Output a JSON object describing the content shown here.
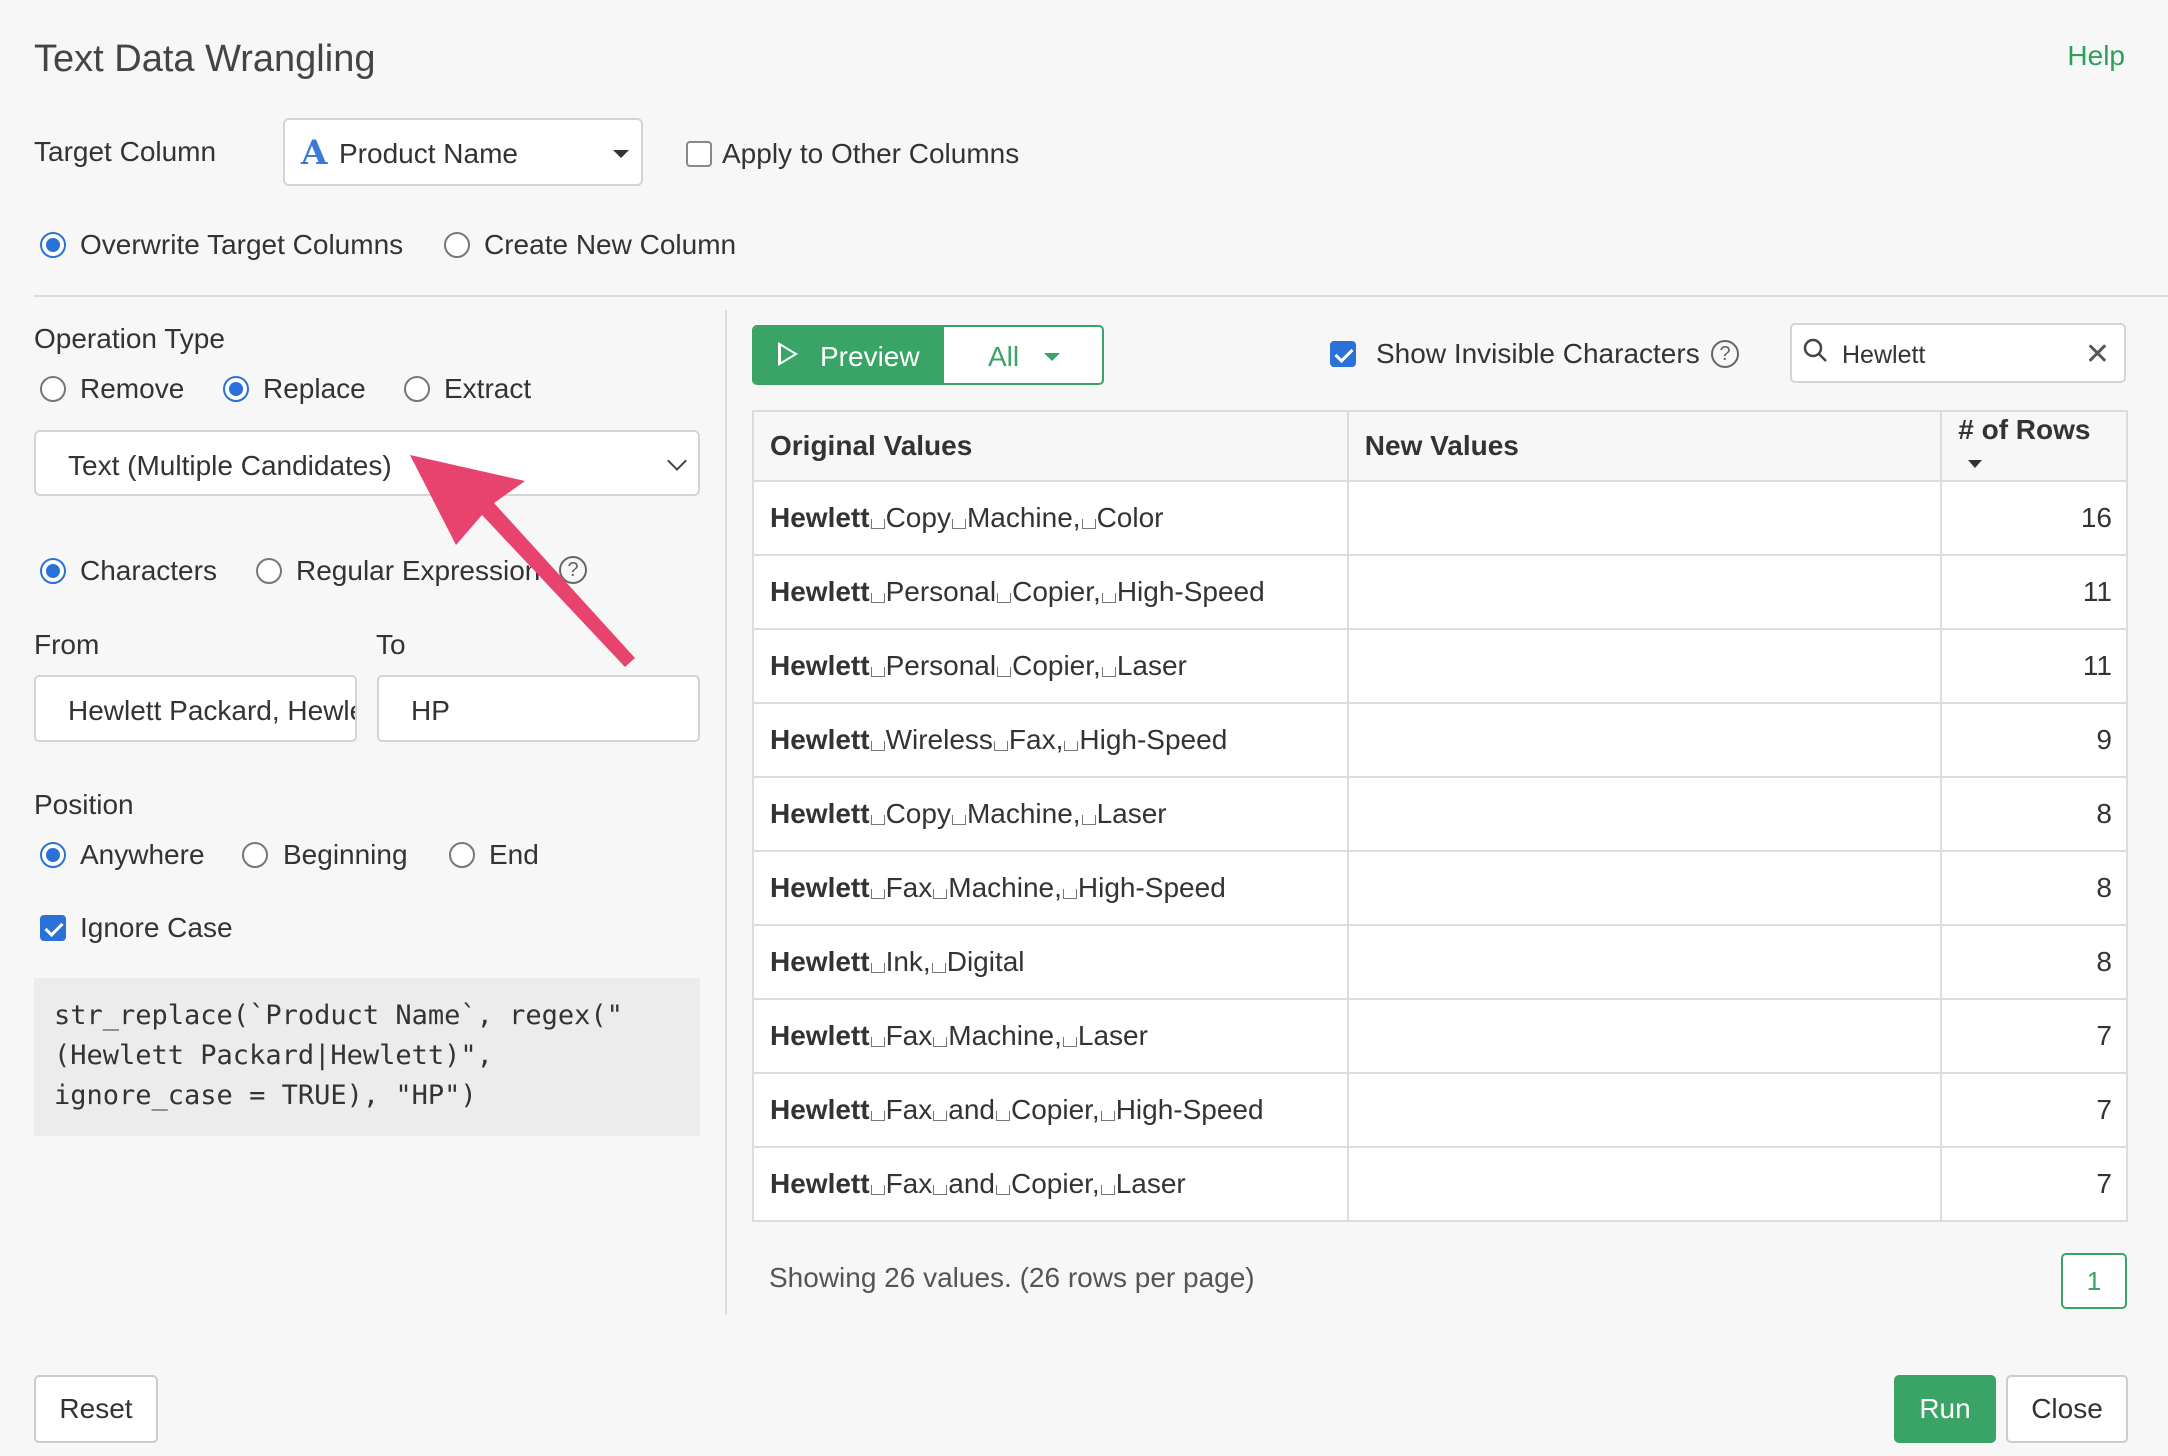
{
  "header": {
    "title": "Text Data Wrangling",
    "help_label": "Help"
  },
  "target_column": {
    "label": "Target Column",
    "selected": "Product Name",
    "type_icon": "A",
    "apply_other_label": "Apply to Other Columns",
    "apply_other_checked": false
  },
  "output_mode": {
    "options": [
      "Overwrite Target Columns",
      "Create New Column"
    ],
    "selected": "Overwrite Target Columns"
  },
  "operation": {
    "label": "Operation Type",
    "options": [
      "Remove",
      "Replace",
      "Extract"
    ],
    "selected": "Replace",
    "method_selected": "Text (Multiple Candidates)",
    "match_options": [
      "Characters",
      "Regular Expression"
    ],
    "match_selected": "Characters"
  },
  "from_to": {
    "from_label": "From",
    "to_label": "To",
    "from_value": "Hewlett Packard, Hewlett",
    "to_value": "HP"
  },
  "position": {
    "label": "Position",
    "options": [
      "Anywhere",
      "Beginning",
      "End"
    ],
    "selected": "Anywhere",
    "ignore_case_label": "Ignore Case",
    "ignore_case_checked": true
  },
  "code": "str_replace(`Product Name`, regex(\"\n(Hewlett Packard|Hewlett)\",\nignore_case = TRUE), \"HP\")",
  "preview": {
    "preview_label": "Preview",
    "filter_label": "All",
    "show_invisible_label": "Show Invisible Characters",
    "show_invisible_checked": true,
    "search_value": "Hewlett"
  },
  "table": {
    "headers": [
      "Original Values",
      "New Values",
      "# of Rows"
    ],
    "rows": [
      {
        "bold": "Hewlett",
        "words": [
          "Copy",
          "Machine,",
          "Color"
        ],
        "new": "",
        "count": "16"
      },
      {
        "bold": "Hewlett",
        "words": [
          "Personal",
          "Copier,",
          "High-Speed"
        ],
        "new": "",
        "count": "11"
      },
      {
        "bold": "Hewlett",
        "words": [
          "Personal",
          "Copier,",
          "Laser"
        ],
        "new": "",
        "count": "11"
      },
      {
        "bold": "Hewlett",
        "words": [
          "Wireless",
          "Fax,",
          "High-Speed"
        ],
        "new": "",
        "count": "9"
      },
      {
        "bold": "Hewlett",
        "words": [
          "Copy",
          "Machine,",
          "Laser"
        ],
        "new": "",
        "count": "8"
      },
      {
        "bold": "Hewlett",
        "words": [
          "Fax",
          "Machine,",
          "High-Speed"
        ],
        "new": "",
        "count": "8"
      },
      {
        "bold": "Hewlett",
        "words": [
          "Ink,",
          "Digital"
        ],
        "new": "",
        "count": "8"
      },
      {
        "bold": "Hewlett",
        "words": [
          "Fax",
          "Machine,",
          "Laser"
        ],
        "new": "",
        "count": "7"
      },
      {
        "bold": "Hewlett",
        "words": [
          "Fax",
          "and",
          "Copier,",
          "High-Speed"
        ],
        "new": "",
        "count": "7"
      },
      {
        "bold": "Hewlett",
        "words": [
          "Fax",
          "and",
          "Copier,",
          "Laser"
        ],
        "new": "",
        "count": "7"
      }
    ]
  },
  "footer": {
    "showing_text": "Showing 26 values. (26 rows per page)",
    "page": "1",
    "reset_label": "Reset",
    "run_label": "Run",
    "close_label": "Close"
  },
  "colors": {
    "accent_green": "#3aa466",
    "check_blue": "#2a72d8",
    "arrow_pink": "#e8436e"
  }
}
